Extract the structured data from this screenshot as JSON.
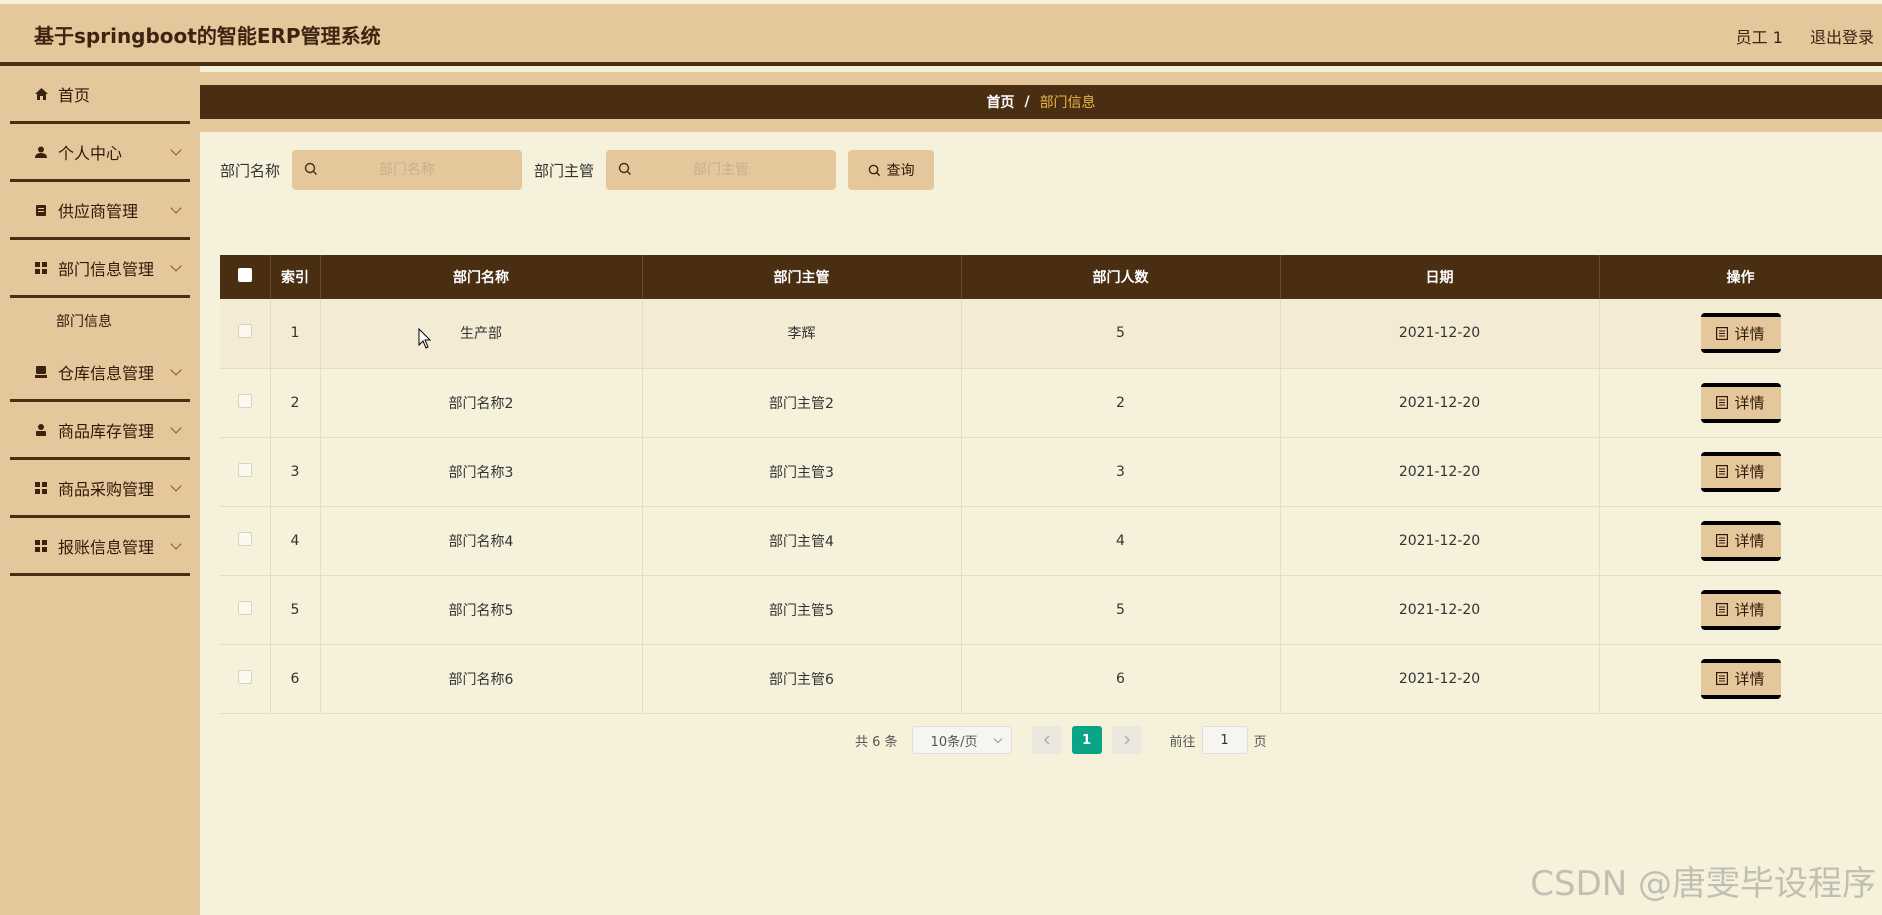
{
  "header": {
    "title": "基于springboot的智能ERP管理系统",
    "user": "员工 1",
    "logout": "退出登录"
  },
  "sidebar": {
    "items": [
      {
        "label": "首页",
        "icon": "home-icon",
        "has_sub": false
      },
      {
        "label": "个人中心",
        "icon": "user-icon",
        "has_sub": true
      },
      {
        "label": "供应商管理",
        "icon": "clipboard-icon",
        "has_sub": true
      },
      {
        "label": "部门信息管理",
        "icon": "grid-icon",
        "has_sub": true,
        "sub": [
          "部门信息"
        ]
      },
      {
        "label": "仓库信息管理",
        "icon": "box-icon",
        "has_sub": true
      },
      {
        "label": "商品库存管理",
        "icon": "person-icon",
        "has_sub": true
      },
      {
        "label": "商品采购管理",
        "icon": "grid-icon",
        "has_sub": true
      },
      {
        "label": "报账信息管理",
        "icon": "grid-icon",
        "has_sub": true
      }
    ]
  },
  "breadcrumb": {
    "home": "首页",
    "separator": "/",
    "current": "部门信息"
  },
  "search": {
    "dept_name_label": "部门名称",
    "dept_name_placeholder": "部门名称",
    "dept_manager_label": "部门主管",
    "dept_manager_placeholder": "部门主管",
    "query_label": "查询"
  },
  "table": {
    "columns": [
      "索引",
      "部门名称",
      "部门主管",
      "部门人数",
      "日期",
      "操作"
    ],
    "detail_label": "详情",
    "rows": [
      {
        "index": "1",
        "name": "生产部",
        "manager": "李辉",
        "count": "5",
        "date": "2021-12-20"
      },
      {
        "index": "2",
        "name": "部门名称2",
        "manager": "部门主管2",
        "count": "2",
        "date": "2021-12-20"
      },
      {
        "index": "3",
        "name": "部门名称3",
        "manager": "部门主管3",
        "count": "3",
        "date": "2021-12-20"
      },
      {
        "index": "4",
        "name": "部门名称4",
        "manager": "部门主管4",
        "count": "4",
        "date": "2021-12-20"
      },
      {
        "index": "5",
        "name": "部门名称5",
        "manager": "部门主管5",
        "count": "5",
        "date": "2021-12-20"
      },
      {
        "index": "6",
        "name": "部门名称6",
        "manager": "部门主管6",
        "count": "6",
        "date": "2021-12-20"
      }
    ]
  },
  "pagination": {
    "total": "共 6 条",
    "page_size": "10条/页",
    "current_page": "1",
    "goto_label": "前往",
    "goto_value": "1",
    "page_suffix": "页"
  },
  "watermark": "CSDN @唐雯毕设程序"
}
